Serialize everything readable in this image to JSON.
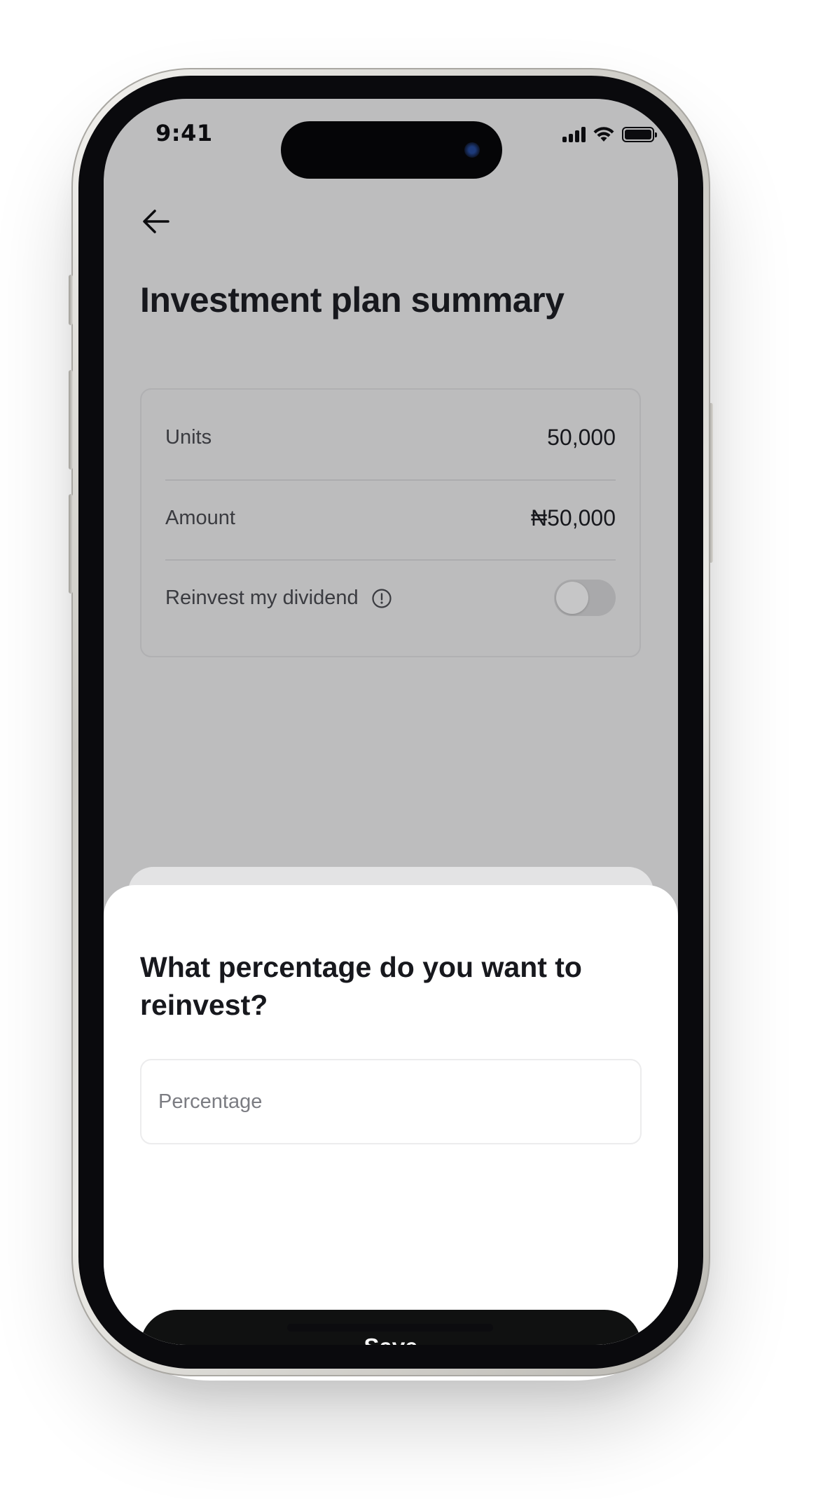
{
  "status_bar": {
    "time": "9:41",
    "icons": [
      "signal-icon",
      "wifi-icon",
      "battery-icon"
    ]
  },
  "header": {
    "back_icon": "arrow-left-icon",
    "title": "Investment plan summary"
  },
  "summary": {
    "rows": [
      {
        "label": "Units",
        "value": "50,000"
      },
      {
        "label": "Amount",
        "value": "₦50,000"
      }
    ],
    "reinvest": {
      "label": "Reinvest my dividend",
      "info_icon": "info-icon",
      "enabled": false
    }
  },
  "sheet": {
    "title": "What percentage do you want to reinvest?",
    "input": {
      "placeholder": "Percentage",
      "value": ""
    },
    "save_label": "Save"
  },
  "colors": {
    "overlay": "#bdbdbe",
    "primary_button": "#101111",
    "text": "#17181d"
  }
}
